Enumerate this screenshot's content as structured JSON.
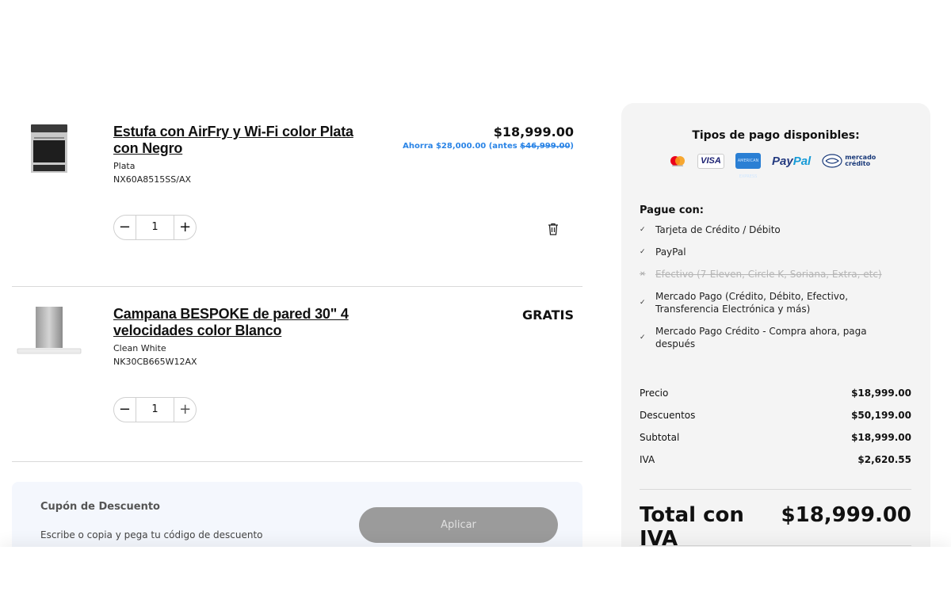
{
  "items": [
    {
      "name": "Estufa con AirFry y Wi-Fi color Plata con Negro",
      "variant": "Plata",
      "sku": "NX60A8515SS/AX",
      "price": "$18,999.00",
      "savings_prefix": "Ahorra $28,000.00 (antes ",
      "savings_original": "$46,999.00",
      "savings_suffix": ")",
      "quantity": "1",
      "minus": "−",
      "plus": "+"
    },
    {
      "name": "Campana BESPOKE de pared 30\" 4 velocidades color Blanco",
      "variant": "Clean White",
      "sku": "NK30CB665W12AX",
      "price": "GRATIS",
      "quantity": "1",
      "minus": "−",
      "plus": "+"
    }
  ],
  "coupon": {
    "title": "Cupón de Descuento",
    "hint": "Escribe o copia y pega tu código de descuento",
    "apply_label": "Aplicar"
  },
  "summary": {
    "payment_title": "Tipos de pago disponibles:",
    "logos": {
      "visa": "VISA",
      "amex": "AMERICAN EXPRESS",
      "paypal_a": "Pay",
      "paypal_b": "Pal",
      "mp_line1": "mercado",
      "mp_line2": "crédito"
    },
    "pay_with_title": "Pague con:",
    "methods": [
      {
        "label": "Tarjeta de Crédito / Débito",
        "mark": "✓"
      },
      {
        "label": "PayPal",
        "mark": "✓"
      },
      {
        "label": "Efectivo (7-Eleven, Circle K, Soriana, Extra, etc)",
        "mark": "×"
      },
      {
        "label": "Mercado Pago (Crédito, Débito, Efectivo, Transferencia Electrónica y más)",
        "mark": "✓"
      },
      {
        "label": "Mercado Pago Crédito - Compra ahora, paga después",
        "mark": "✓"
      }
    ],
    "rows": [
      {
        "label": "Precio",
        "value": "$18,999.00"
      },
      {
        "label": "Descuentos",
        "value": "$50,199.00"
      },
      {
        "label": "Subtotal",
        "value": "$18,999.00"
      },
      {
        "label": "IVA",
        "value": "$2,620.55"
      }
    ],
    "total_label": "Total con IVA",
    "total_value": "$18,999.00"
  },
  "colors": {
    "savings_blue": "#2a84e6",
    "panel_bg": "#f4f4f4",
    "coupon_bg": "#f4f7fd",
    "apply_bg": "#9b9b9b"
  }
}
